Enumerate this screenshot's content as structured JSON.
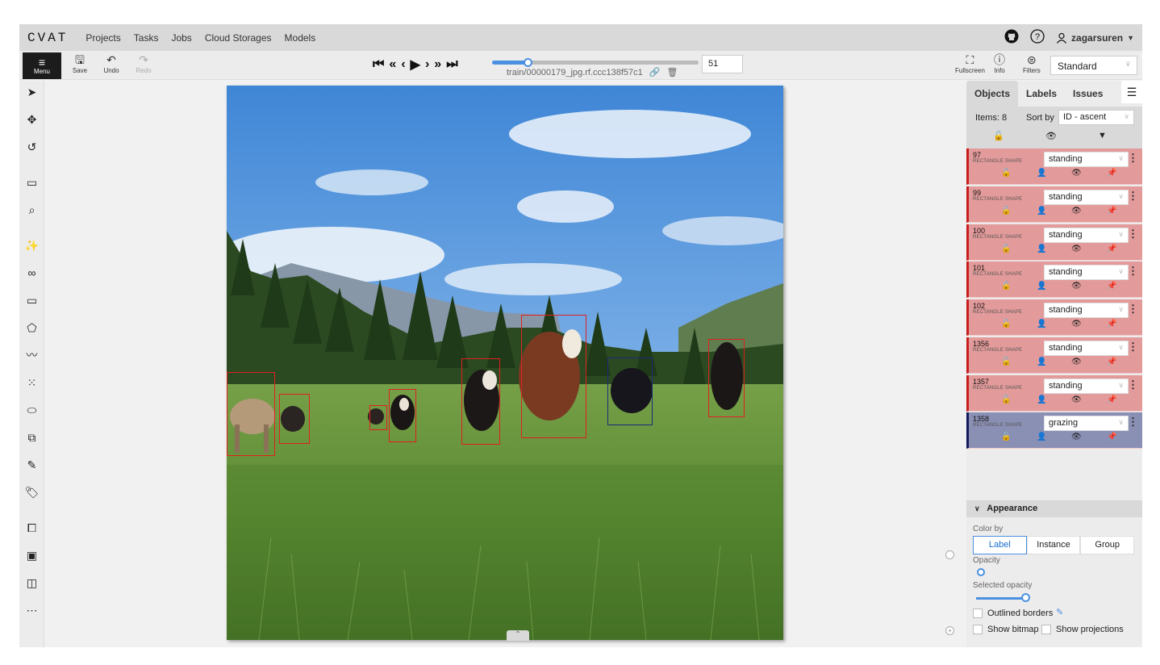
{
  "nav": {
    "logo": "CVAT",
    "links": [
      "Projects",
      "Tasks",
      "Jobs",
      "Cloud Storages",
      "Models"
    ],
    "username": "zagarsuren",
    "github_icon": "github-icon",
    "help_icon": "help-icon"
  },
  "toolbar": {
    "menu_label": "Menu",
    "save_label": "Save",
    "undo_label": "Undo",
    "redo_label": "Redo",
    "filename": "train/00000179_jpg.rf.ccc138f57c1",
    "frame_number": "51",
    "frame_progress": 0.17,
    "fullscreen_label": "Fullscreen",
    "info_label": "Info",
    "filters_label": "Filters",
    "workspace": "Standard"
  },
  "sidebar": {
    "tabs": [
      "Objects",
      "Labels",
      "Issues"
    ],
    "items_count": "Items: 8",
    "sort_by_label": "Sort by",
    "sort_value": "ID - ascent",
    "objects": [
      {
        "id": "97",
        "type": "RECTANGLE SHAPE",
        "label": "standing"
      },
      {
        "id": "99",
        "type": "RECTANGLE SHAPE",
        "label": "standing"
      },
      {
        "id": "100",
        "type": "RECTANGLE SHAPE",
        "label": "standing"
      },
      {
        "id": "101",
        "type": "RECTANGLE SHAPE",
        "label": "standing"
      },
      {
        "id": "102",
        "type": "RECTANGLE SHAPE",
        "label": "standing"
      },
      {
        "id": "1356",
        "type": "RECTANGLE SHAPE",
        "label": "standing"
      },
      {
        "id": "1357",
        "type": "RECTANGLE SHAPE",
        "label": "standing"
      },
      {
        "id": "1358",
        "type": "RECTANGLE SHAPE",
        "label": "grazing"
      }
    ],
    "appearance": {
      "title": "Appearance",
      "color_by_label": "Color by",
      "color_by_options": [
        "Label",
        "Instance",
        "Group"
      ],
      "color_by_selected": "Label",
      "opacity_label": "Opacity",
      "opacity_value": 0,
      "selected_opacity_label": "Selected opacity",
      "selected_opacity_value": 0.3,
      "outlined_borders_label": "Outlined borders",
      "show_bitmap_label": "Show bitmap",
      "show_projections_label": "Show projections"
    }
  },
  "colors": {
    "standing": "#e02020",
    "grazing": "#1a2a7a",
    "accent": "#4a90e2"
  }
}
